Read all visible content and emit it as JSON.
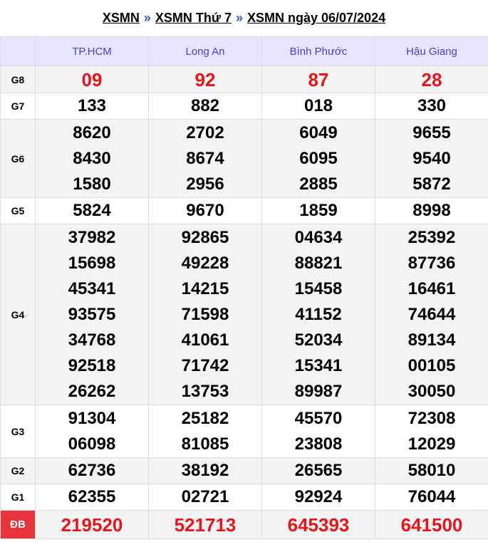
{
  "breadcrumb": {
    "items": [
      "XSMN",
      "XSMN Thứ 7",
      "XSMN ngày 06/07/2024"
    ],
    "separator": "»"
  },
  "table": {
    "provinces": [
      "TP.HCM",
      "Long An",
      "Bình Phước",
      "Hậu Giang"
    ],
    "rows": [
      {
        "label": "G8",
        "values": [
          [
            "09"
          ],
          [
            "92"
          ],
          [
            "87"
          ],
          [
            "28"
          ]
        ]
      },
      {
        "label": "G7",
        "values": [
          [
            "133"
          ],
          [
            "882"
          ],
          [
            "018"
          ],
          [
            "330"
          ]
        ]
      },
      {
        "label": "G6",
        "values": [
          [
            "8620",
            "8430",
            "1580"
          ],
          [
            "2702",
            "8674",
            "2956"
          ],
          [
            "6049",
            "6095",
            "2885"
          ],
          [
            "9655",
            "9540",
            "5872"
          ]
        ]
      },
      {
        "label": "G5",
        "values": [
          [
            "5824"
          ],
          [
            "9670"
          ],
          [
            "1859"
          ],
          [
            "8998"
          ]
        ]
      },
      {
        "label": "G4",
        "values": [
          [
            "37982",
            "15698",
            "45341",
            "93575",
            "34768",
            "92518",
            "26262"
          ],
          [
            "92865",
            "49228",
            "14215",
            "71598",
            "41061",
            "71742",
            "13753"
          ],
          [
            "04634",
            "88821",
            "15458",
            "41152",
            "52034",
            "15341",
            "89987"
          ],
          [
            "25392",
            "87736",
            "16461",
            "74644",
            "89134",
            "00105",
            "30050"
          ]
        ]
      },
      {
        "label": "G3",
        "values": [
          [
            "91304",
            "06098"
          ],
          [
            "25182",
            "81085"
          ],
          [
            "45570",
            "23808"
          ],
          [
            "72308",
            "12029"
          ]
        ]
      },
      {
        "label": "G2",
        "values": [
          [
            "62736"
          ],
          [
            "38192"
          ],
          [
            "26565"
          ],
          [
            "58010"
          ]
        ]
      },
      {
        "label": "G1",
        "values": [
          [
            "62355"
          ],
          [
            "02721"
          ],
          [
            "92924"
          ],
          [
            "76044"
          ]
        ]
      },
      {
        "label": "ĐB",
        "values": [
          [
            "219520"
          ],
          [
            "521713"
          ],
          [
            "645393"
          ],
          [
            "641500"
          ]
        ]
      }
    ]
  },
  "colors": {
    "header_bg": "#e6e4ff",
    "header_text": "#4b3ec8",
    "highlight_red": "#e8141c",
    "db_label_bg": "#e8333c",
    "row_shade": "#f3f3f3"
  }
}
